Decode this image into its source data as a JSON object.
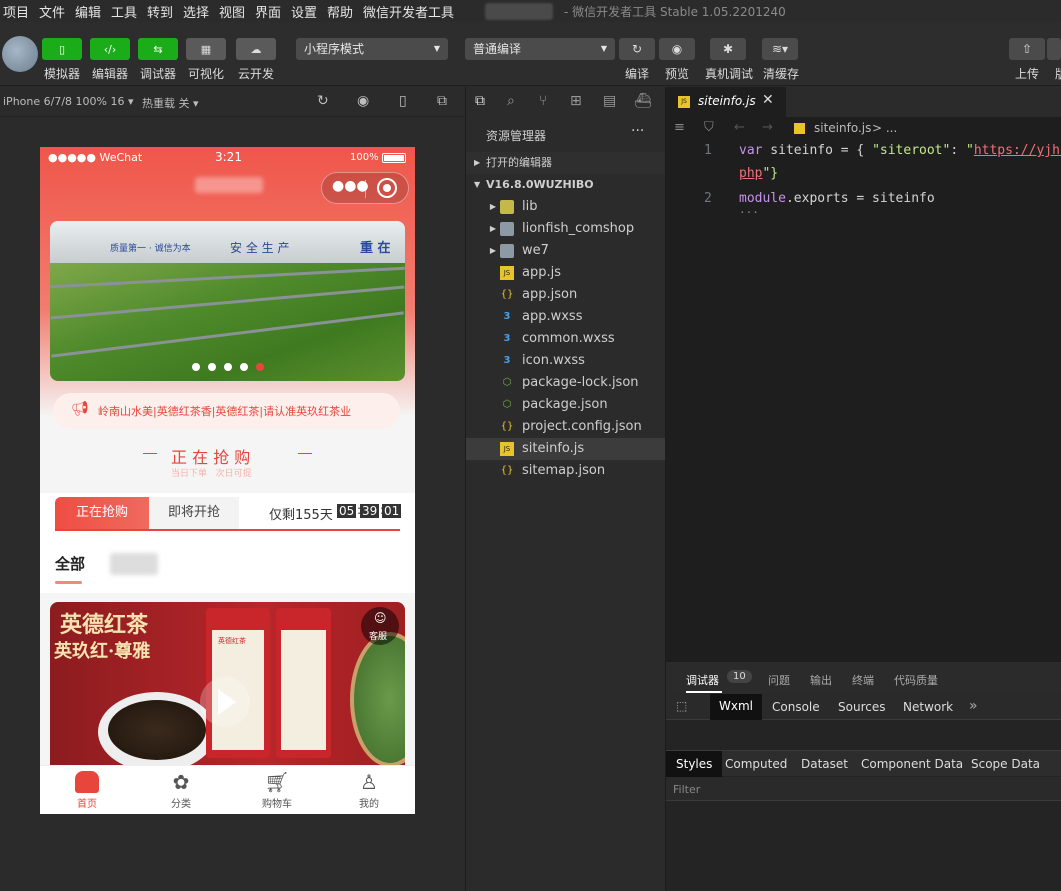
{
  "menu": [
    "项目",
    "文件",
    "编辑",
    "工具",
    "转到",
    "选择",
    "视图",
    "界面",
    "设置",
    "帮助",
    "微信开发者工具"
  ],
  "window_title": "- 微信开发者工具 Stable 1.05.2201240",
  "toolbar": {
    "simulator": "模拟器",
    "editor": "编辑器",
    "debugger": "调试器",
    "visual": "可视化",
    "cloud": "云开发",
    "mode_select": "小程序模式",
    "compile_select": "普通编译",
    "compile": "编译",
    "preview": "预览",
    "real_debug": "真机调试",
    "clear_cache": "清缓存",
    "upload": "上传",
    "version_partial": "版"
  },
  "simbar": {
    "device": "iPhone 6/7/8 100% 16",
    "hot_reload": "热重载 关"
  },
  "phone": {
    "status_carrier": "●●●●● WeChat",
    "status_time": "3:21",
    "status_battery": "100%",
    "banner_sign1": "质量第一 · 诚信为本",
    "banner_sign2": "安 全 生 产",
    "banner_sign3": "重 在",
    "notice": "岭南山水美|英德红茶香|英德红茶|请认准英玖红茶业",
    "section_title": "正 在 抢 购",
    "section_sub": "当日下单   次日可提",
    "tab_active": "正在抢购",
    "tab_inactive": "即将开抢",
    "remain_label": "仅剩155天",
    "countdown": [
      "05",
      "39",
      "01"
    ],
    "cat_all": "全部",
    "product_title1": "英德红茶",
    "product_title2": "英玖红·尊雅",
    "can_label": "英德红茶",
    "service": "客服",
    "nav": [
      "首页",
      "分类",
      "购物车",
      "我的"
    ]
  },
  "explorer": {
    "title": "资源管理器",
    "open_editors": "打开的编辑器",
    "project": "V16.8.0WUZHIBO",
    "files": [
      {
        "name": "lib",
        "type": "folder-lib"
      },
      {
        "name": "lionfish_comshop",
        "type": "folder"
      },
      {
        "name": "we7",
        "type": "folder"
      },
      {
        "name": "app.js",
        "type": "js"
      },
      {
        "name": "app.json",
        "type": "json"
      },
      {
        "name": "app.wxss",
        "type": "wxss"
      },
      {
        "name": "common.wxss",
        "type": "wxss"
      },
      {
        "name": "icon.wxss",
        "type": "wxss"
      },
      {
        "name": "package-lock.json",
        "type": "npm"
      },
      {
        "name": "package.json",
        "type": "npm"
      },
      {
        "name": "project.config.json",
        "type": "json"
      },
      {
        "name": "siteinfo.js",
        "type": "js"
      },
      {
        "name": "sitemap.json",
        "type": "json"
      }
    ]
  },
  "editor": {
    "tab": "siteinfo.js",
    "breadcrumb_file": "siteinfo.js",
    "breadcrumb_rest": "> ...",
    "line1_num": "1",
    "line2_num": "2",
    "l1_kw": "var",
    "l1_var": " siteinfo = { ",
    "l1_key": "\"siteroot\"",
    "l1_colon": ": ",
    "l1_q": "\"",
    "l1_url": "https://yjh.",
    "l1_url2": "php",
    "l1_end": "\"}",
    "l2_mod": "module",
    "l2_rest": ".exports = siteinfo",
    "l2_dots": "..."
  },
  "devtools": {
    "tabs": [
      "调试器",
      "问题",
      "输出",
      "终端",
      "代码质量"
    ],
    "badge": "10",
    "panels": [
      "Wxml",
      "Console",
      "Sources",
      "Network"
    ],
    "more": "»",
    "subtabs": [
      "Styles",
      "Computed",
      "Dataset",
      "Component Data",
      "Scope Data"
    ],
    "filter": "Filter"
  },
  "colors": {
    "accent_red": "#e8453c",
    "green": "#1aad19"
  }
}
